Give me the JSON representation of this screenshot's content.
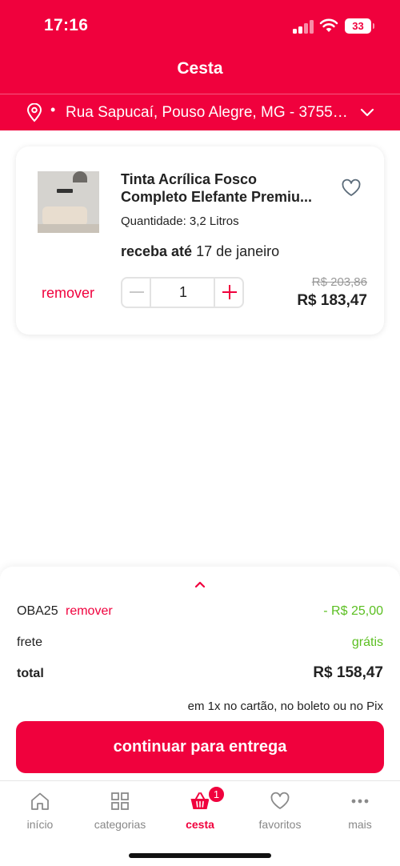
{
  "status_bar": {
    "time": "17:16",
    "battery": "33"
  },
  "header": {
    "title": "Cesta",
    "address_bullet": "•",
    "address": "Rua Sapucaí, Pouso Alegre, MG - 37558-..."
  },
  "product": {
    "name_line1": "Tinta Acrílica Fosco",
    "name_line2": "Completo Elefante Premiu...",
    "quantity_label": "Quantidade: 3,2 Litros",
    "delivery_prefix": "receba até",
    "delivery_date": "17 de janeiro",
    "remove_label": "remover",
    "quantity": "1",
    "old_price": "R$ 203,86",
    "new_price": "R$ 183,47"
  },
  "summary": {
    "coupon_code": "OBA25",
    "coupon_remove": "remover",
    "coupon_value": "- R$ 25,00",
    "shipping_label": "frete",
    "shipping_value": "grátis",
    "total_label": "total",
    "total_value": "R$ 158,47",
    "payment_note": "em 1x no cartão, no boleto ou no Pix",
    "cta_label": "continuar para entrega"
  },
  "tabbar": {
    "items": [
      {
        "label": "início",
        "icon": "home-icon"
      },
      {
        "label": "categorias",
        "icon": "grid-icon"
      },
      {
        "label": "cesta",
        "icon": "basket-icon",
        "badge": "1"
      },
      {
        "label": "favoritos",
        "icon": "heart-icon"
      },
      {
        "label": "mais",
        "icon": "more-icon"
      }
    ],
    "active_index": 2
  },
  "colors": {
    "brand": "#f0013d",
    "success": "#5bbf21",
    "muted": "#888888"
  }
}
